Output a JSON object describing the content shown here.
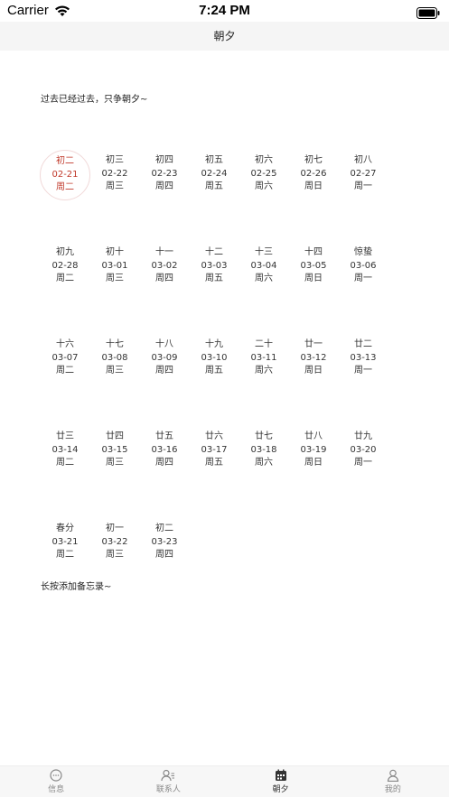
{
  "status_bar": {
    "carrier": "Carrier",
    "time": "7:24 PM"
  },
  "nav": {
    "title": "朝夕"
  },
  "motto": "过去已经过去，只争朝夕~",
  "hint": "长按添加备忘录~",
  "calendar": {
    "today_index": 0,
    "days": [
      {
        "lunar": "初二",
        "date": "02-21",
        "weekday": "周二"
      },
      {
        "lunar": "初三",
        "date": "02-22",
        "weekday": "周三"
      },
      {
        "lunar": "初四",
        "date": "02-23",
        "weekday": "周四"
      },
      {
        "lunar": "初五",
        "date": "02-24",
        "weekday": "周五"
      },
      {
        "lunar": "初六",
        "date": "02-25",
        "weekday": "周六"
      },
      {
        "lunar": "初七",
        "date": "02-26",
        "weekday": "周日"
      },
      {
        "lunar": "初八",
        "date": "02-27",
        "weekday": "周一"
      },
      {
        "lunar": "初九",
        "date": "02-28",
        "weekday": "周二"
      },
      {
        "lunar": "初十",
        "date": "03-01",
        "weekday": "周三"
      },
      {
        "lunar": "十一",
        "date": "03-02",
        "weekday": "周四"
      },
      {
        "lunar": "十二",
        "date": "03-03",
        "weekday": "周五"
      },
      {
        "lunar": "十三",
        "date": "03-04",
        "weekday": "周六"
      },
      {
        "lunar": "十四",
        "date": "03-05",
        "weekday": "周日"
      },
      {
        "lunar": "惊蛰",
        "date": "03-06",
        "weekday": "周一"
      },
      {
        "lunar": "十六",
        "date": "03-07",
        "weekday": "周二"
      },
      {
        "lunar": "十七",
        "date": "03-08",
        "weekday": "周三"
      },
      {
        "lunar": "十八",
        "date": "03-09",
        "weekday": "周四"
      },
      {
        "lunar": "十九",
        "date": "03-10",
        "weekday": "周五"
      },
      {
        "lunar": "二十",
        "date": "03-11",
        "weekday": "周六"
      },
      {
        "lunar": "廿一",
        "date": "03-12",
        "weekday": "周日"
      },
      {
        "lunar": "廿二",
        "date": "03-13",
        "weekday": "周一"
      },
      {
        "lunar": "廿三",
        "date": "03-14",
        "weekday": "周二"
      },
      {
        "lunar": "廿四",
        "date": "03-15",
        "weekday": "周三"
      },
      {
        "lunar": "廿五",
        "date": "03-16",
        "weekday": "周四"
      },
      {
        "lunar": "廿六",
        "date": "03-17",
        "weekday": "周五"
      },
      {
        "lunar": "廿七",
        "date": "03-18",
        "weekday": "周六"
      },
      {
        "lunar": "廿八",
        "date": "03-19",
        "weekday": "周日"
      },
      {
        "lunar": "廿九",
        "date": "03-20",
        "weekday": "周一"
      },
      {
        "lunar": "春分",
        "date": "03-21",
        "weekday": "周二"
      },
      {
        "lunar": "初一",
        "date": "03-22",
        "weekday": "周三"
      },
      {
        "lunar": "初二",
        "date": "03-23",
        "weekday": "周四"
      }
    ]
  },
  "tabs": [
    {
      "label": "信息",
      "icon": "chat-bubble-icon",
      "active": false
    },
    {
      "label": "联系人",
      "icon": "contacts-icon",
      "active": false
    },
    {
      "label": "朝夕",
      "icon": "calendar-icon",
      "active": true
    },
    {
      "label": "我的",
      "icon": "person-icon",
      "active": false
    }
  ],
  "colors": {
    "today": "#c0392b",
    "nav_bg": "#f5f5f5",
    "tab_active": "#333333",
    "tab_inactive": "#888888"
  }
}
